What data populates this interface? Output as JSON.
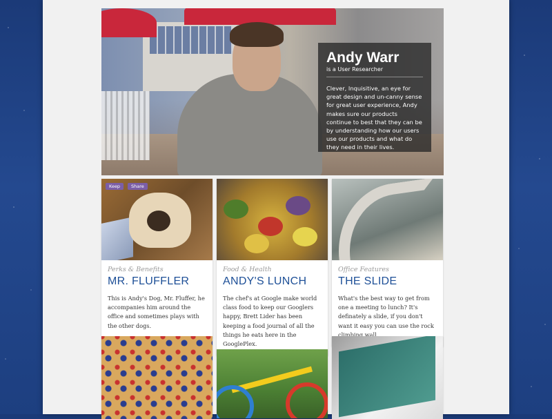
{
  "hero": {
    "name": "Andy Warr",
    "role": "is a User Researcher",
    "bio": "Clever, Inquisitive, an eye for great design and un-canny sense for great user experience, Andy makes sure our products continue to best that they can be by understanding how our users use our products and what do they need in their lives."
  },
  "cards": [
    {
      "category": "Perks & Benefits",
      "title": "MR. FLUFFLER",
      "description": "This is Andy's Dog, Mr. Fluffer, he accompanies him around the office and sometimes plays with the other dogs.",
      "keep_label": "Keep",
      "share_label": "Share"
    },
    {
      "category": "Food & Health",
      "title": "ANDY'S LUNCH",
      "description": "The chef's at Google make world class food to keep our Googlers happy, Brett Lider has been keeping a food journal of all the things he eats here in the GooglePlex."
    },
    {
      "category": "Office Features",
      "title": "THE SLIDE",
      "description": "What's the best way to get from one a meeting to lunch? It's definately a slide, if you don't want it easy you can use the rock climbing wall."
    }
  ],
  "colors": {
    "title_blue": "#1d4f97",
    "button_purple": "#7b5ea7",
    "background_blue": "#24498f"
  },
  "icons": [
    "starfield-background"
  ]
}
